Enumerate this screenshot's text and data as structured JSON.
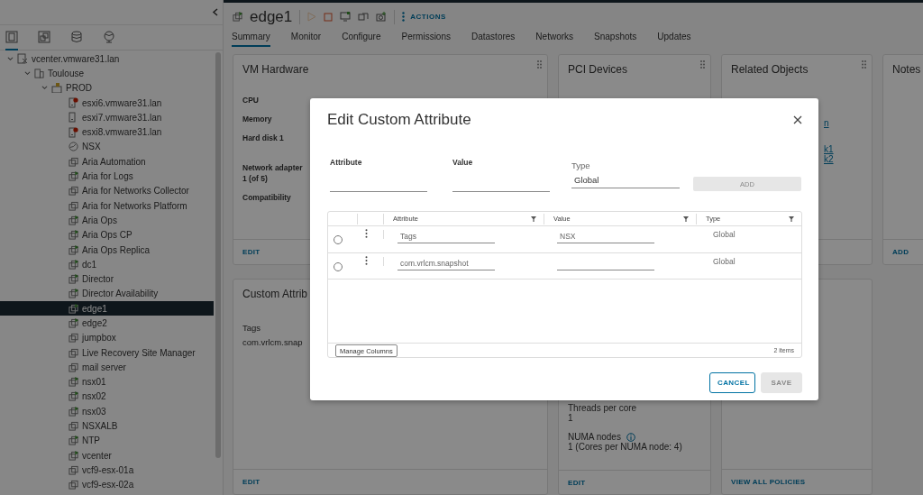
{
  "sidebar": {
    "nav_tabs": [
      {
        "kind": "hosts",
        "selected": true
      },
      {
        "kind": "vms",
        "selected": false
      },
      {
        "kind": "storage",
        "selected": false
      },
      {
        "kind": "network",
        "selected": false
      }
    ],
    "tree": [
      {
        "kind": "vcenter",
        "label": "vcenter.vmware31.lan",
        "expanded": true,
        "selected": false,
        "children": [
          {
            "kind": "datacenter",
            "label": "Toulouse",
            "expanded": true,
            "selected": false,
            "children": [
              {
                "kind": "cluster",
                "label": "PROD",
                "expanded": true,
                "selected": false,
                "children": [
                  {
                    "kind": "host",
                    "label": "esxi6.vmware31.lan",
                    "alert": true,
                    "selected": false
                  },
                  {
                    "kind": "host",
                    "label": "esxi7.vmware31.lan",
                    "alert": false,
                    "selected": false
                  },
                  {
                    "kind": "host",
                    "label": "esxi8.vmware31.lan",
                    "alert": true,
                    "selected": false
                  },
                  {
                    "kind": "appliance",
                    "label": "NSX",
                    "selected": false
                  },
                  {
                    "kind": "vm",
                    "label": "Aria Automation",
                    "powered_on": false,
                    "selected": false
                  },
                  {
                    "kind": "vm",
                    "label": "Aria for Logs",
                    "powered_on": true,
                    "selected": false
                  },
                  {
                    "kind": "vm",
                    "label": "Aria for Networks Collector",
                    "powered_on": false,
                    "selected": false
                  },
                  {
                    "kind": "vm",
                    "label": "Aria for Networks Platform",
                    "powered_on": false,
                    "selected": false
                  },
                  {
                    "kind": "vm",
                    "label": "Aria Ops",
                    "powered_on": true,
                    "selected": false
                  },
                  {
                    "kind": "vm",
                    "label": "Aria Ops CP",
                    "powered_on": true,
                    "selected": false
                  },
                  {
                    "kind": "vm",
                    "label": "Aria Ops Replica",
                    "powered_on": true,
                    "selected": false
                  },
                  {
                    "kind": "vm",
                    "label": "dc1",
                    "powered_on": true,
                    "selected": false
                  },
                  {
                    "kind": "vm",
                    "label": "Director",
                    "powered_on": true,
                    "selected": false
                  },
                  {
                    "kind": "vm",
                    "label": "Director Availability",
                    "powered_on": true,
                    "selected": false
                  },
                  {
                    "kind": "vm",
                    "label": "edge1",
                    "powered_on": true,
                    "selected": true
                  },
                  {
                    "kind": "vm",
                    "label": "edge2",
                    "powered_on": true,
                    "selected": false
                  },
                  {
                    "kind": "vm",
                    "label": "jumpbox",
                    "powered_on": false,
                    "selected": false
                  },
                  {
                    "kind": "vm",
                    "label": "Live Recovery Site Manager",
                    "powered_on": false,
                    "selected": false
                  },
                  {
                    "kind": "vm",
                    "label": "mail server",
                    "powered_on": false,
                    "selected": false
                  },
                  {
                    "kind": "vm",
                    "label": "nsx01",
                    "powered_on": true,
                    "selected": false
                  },
                  {
                    "kind": "vm",
                    "label": "nsx02",
                    "powered_on": true,
                    "selected": false
                  },
                  {
                    "kind": "vm",
                    "label": "nsx03",
                    "powered_on": true,
                    "selected": false
                  },
                  {
                    "kind": "vm",
                    "label": "NSXALB",
                    "powered_on": false,
                    "selected": false
                  },
                  {
                    "kind": "vm",
                    "label": "NTP",
                    "powered_on": true,
                    "selected": false
                  },
                  {
                    "kind": "vm",
                    "label": "vcenter",
                    "powered_on": true,
                    "selected": false
                  },
                  {
                    "kind": "vm",
                    "label": "vcf9-esx-01a",
                    "powered_on": false,
                    "selected": false
                  },
                  {
                    "kind": "vm",
                    "label": "vcf9-esx-02a",
                    "powered_on": false,
                    "selected": false
                  }
                ]
              }
            ]
          }
        ]
      }
    ]
  },
  "header": {
    "title": "edge1",
    "powered_on": true,
    "toolbar": [
      {
        "kind": "play",
        "disabled": true
      },
      {
        "kind": "stop",
        "disabled": false
      },
      {
        "kind": "console",
        "disabled": false
      },
      {
        "kind": "migrate",
        "disabled": false
      },
      {
        "kind": "snapshot",
        "disabled": false
      }
    ],
    "actions": "ACTIONS"
  },
  "tabs": [
    {
      "label": "Summary",
      "selected": true
    },
    {
      "label": "Monitor",
      "selected": false
    },
    {
      "label": "Configure",
      "selected": false
    },
    {
      "label": "Permissions",
      "selected": false
    },
    {
      "label": "Datastores",
      "selected": false
    },
    {
      "label": "Networks",
      "selected": false
    },
    {
      "label": "Snapshots",
      "selected": false
    },
    {
      "label": "Updates",
      "selected": false
    }
  ],
  "cards_top": [
    {
      "title": "VM Hardware",
      "fields": [
        "CPU",
        "Memory",
        "Hard disk 1",
        "Network adapter 1 (of 5)",
        "Compatibility"
      ],
      "action": "EDIT"
    },
    {
      "title": "PCI Devices"
    },
    {
      "title": "Related Objects",
      "links": [
        "n",
        "k1",
        "k2"
      ]
    },
    {
      "title": "Notes",
      "action": "ADD"
    }
  ],
  "cards_bottom": [
    {
      "title": "Custom Attrib",
      "lines": [
        "Tags",
        "com.vrlcm.snap"
      ],
      "action": "EDIT"
    },
    {
      "details": [
        {
          "label": "Threads per core",
          "value": "1",
          "info": false
        },
        {
          "label": "NUMA nodes",
          "value": "1 (Cores per NUMA node: 4)",
          "info": true
        }
      ],
      "action": "EDIT"
    },
    {
      "action": "VIEW ALL POLICIES"
    }
  ],
  "dialog": {
    "title": "Edit Custom Attribute",
    "form": {
      "attribute_label": "Attribute",
      "value_label": "Value",
      "type_label": "Type",
      "type_value": "Global",
      "add_button": {
        "label": "ADD",
        "disabled": true
      }
    },
    "grid": {
      "columns": [
        "Attribute",
        "Value",
        "Type"
      ],
      "rows": [
        {
          "selected": false,
          "attribute": "Tags",
          "value": "NSX",
          "type": "Global"
        },
        {
          "selected": false,
          "attribute": "com.vrlcm.snapshot",
          "type": "Global"
        }
      ],
      "manage_columns": "Manage Columns",
      "count": "2 items"
    },
    "buttons": [
      {
        "label": "CANCEL",
        "kind": "secondary",
        "disabled": false
      },
      {
        "label": "SAVE",
        "kind": "primary",
        "disabled": true
      }
    ]
  }
}
